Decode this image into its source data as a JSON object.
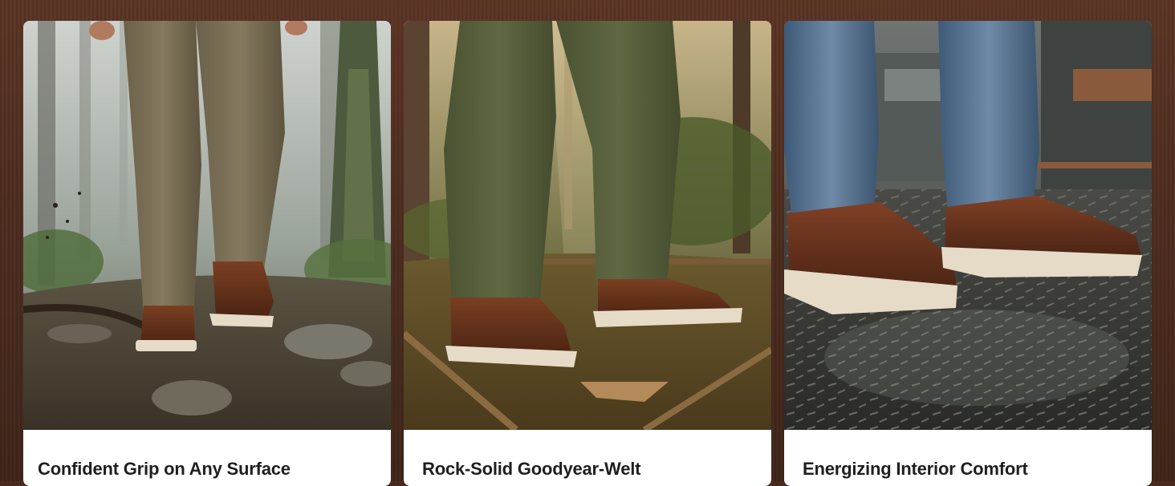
{
  "features": [
    {
      "title": "Confident Grip on Any Surface"
    },
    {
      "title": "Rock-Solid Goodyear-Welt"
    },
    {
      "title": "Energizing Interior Comfort"
    }
  ],
  "colors": {
    "background": "#4a2a1e",
    "card": "#ffffff",
    "caption_text": "#1f1f1f",
    "boot_leather": "#5e2e1a",
    "boot_sole": "#e9ddc8"
  }
}
